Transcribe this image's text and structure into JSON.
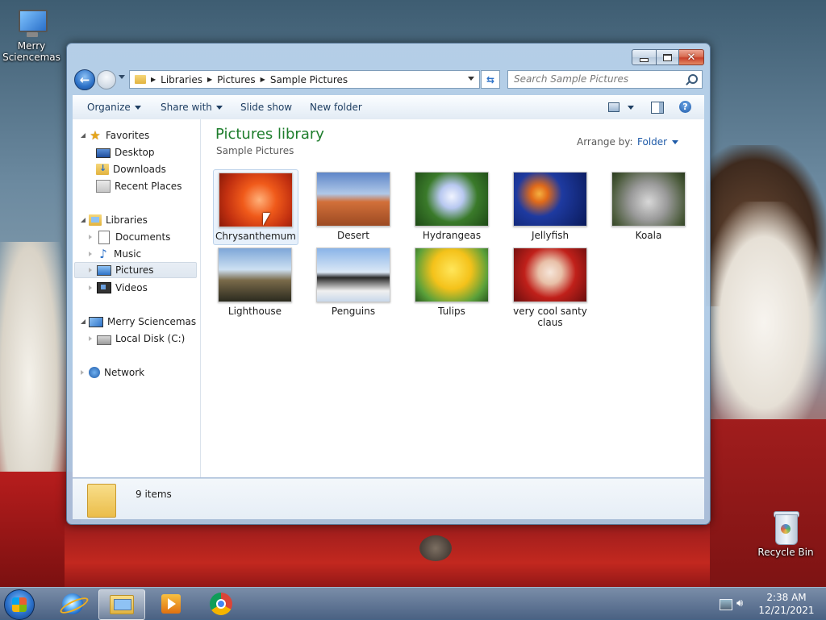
{
  "desktop": {
    "icons": [
      {
        "label": "Merry\nSciencemas",
        "line1": "Merry",
        "line2": "Sciencemas"
      },
      {
        "label": "Recycle Bin"
      }
    ]
  },
  "window": {
    "address": {
      "crumbs": [
        "Libraries",
        "Pictures",
        "Sample Pictures"
      ]
    },
    "search": {
      "placeholder": "Search Sample Pictures"
    },
    "toolbar": {
      "organize": "Organize",
      "share_with": "Share with",
      "slide_show": "Slide show",
      "new_folder": "New folder"
    },
    "nav": {
      "favorites": "Favorites",
      "desktop": "Desktop",
      "downloads": "Downloads",
      "recent_places": "Recent Places",
      "libraries": "Libraries",
      "documents": "Documents",
      "music": "Music",
      "pictures": "Pictures",
      "videos": "Videos",
      "computer": "Merry Sciencemas",
      "local_disk": "Local Disk (C:)",
      "network": "Network"
    },
    "content": {
      "title": "Pictures library",
      "subtitle": "Sample Pictures",
      "arrange_label": "Arrange by:",
      "arrange_value": "Folder",
      "items": [
        {
          "name": "Chrysanthemum"
        },
        {
          "name": "Desert"
        },
        {
          "name": "Hydrangeas"
        },
        {
          "name": "Jellyfish"
        },
        {
          "name": "Koala"
        },
        {
          "name": "Lighthouse"
        },
        {
          "name": "Penguins"
        },
        {
          "name": "Tulips"
        },
        {
          "name": "very cool santy\nclaus",
          "line1": "very cool santy",
          "line2": "claus"
        }
      ]
    },
    "details": {
      "count": "9 items"
    }
  },
  "taskbar": {
    "time": "2:38 AM",
    "date": "12/21/2021"
  }
}
